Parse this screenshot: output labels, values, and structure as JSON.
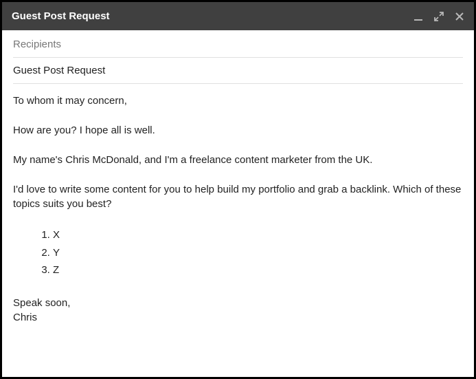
{
  "header": {
    "title": "Guest Post Request"
  },
  "recipients": {
    "placeholder": "Recipients"
  },
  "subject": {
    "value": "Guest Post Request"
  },
  "body": {
    "p1": "To whom it may concern,",
    "p2": "How are you? I hope all is well.",
    "p3": "My name's Chris McDonald, and I'm a freelance content marketer from the UK.",
    "p4": "I'd love to write some content for you to help build my portfolio and grab a backlink. Which of these topics suits you best?",
    "list": {
      "i1": "X",
      "i2": "Y",
      "i3": "Z"
    },
    "closing1": "Speak soon,",
    "closing2": "Chris"
  }
}
